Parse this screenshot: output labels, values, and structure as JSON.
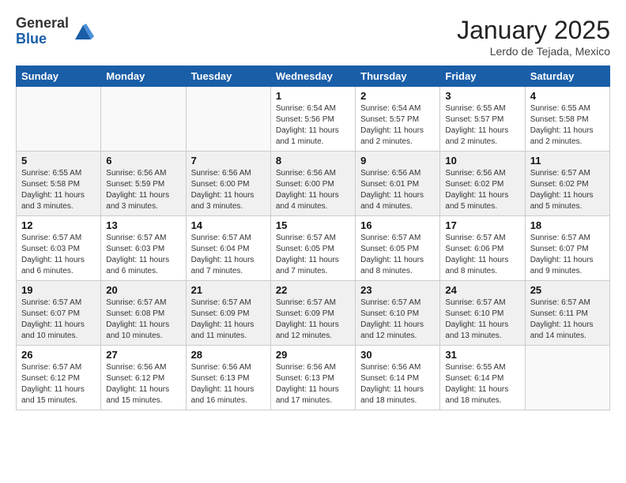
{
  "header": {
    "logo_general": "General",
    "logo_blue": "Blue",
    "month_title": "January 2025",
    "location": "Lerdo de Tejada, Mexico"
  },
  "weekdays": [
    "Sunday",
    "Monday",
    "Tuesday",
    "Wednesday",
    "Thursday",
    "Friday",
    "Saturday"
  ],
  "weeks": [
    {
      "shaded": false,
      "days": [
        {
          "number": "",
          "text": ""
        },
        {
          "number": "",
          "text": ""
        },
        {
          "number": "",
          "text": ""
        },
        {
          "number": "1",
          "text": "Sunrise: 6:54 AM\nSunset: 5:56 PM\nDaylight: 11 hours and 1 minute."
        },
        {
          "number": "2",
          "text": "Sunrise: 6:54 AM\nSunset: 5:57 PM\nDaylight: 11 hours and 2 minutes."
        },
        {
          "number": "3",
          "text": "Sunrise: 6:55 AM\nSunset: 5:57 PM\nDaylight: 11 hours and 2 minutes."
        },
        {
          "number": "4",
          "text": "Sunrise: 6:55 AM\nSunset: 5:58 PM\nDaylight: 11 hours and 2 minutes."
        }
      ]
    },
    {
      "shaded": true,
      "days": [
        {
          "number": "5",
          "text": "Sunrise: 6:55 AM\nSunset: 5:58 PM\nDaylight: 11 hours and 3 minutes."
        },
        {
          "number": "6",
          "text": "Sunrise: 6:56 AM\nSunset: 5:59 PM\nDaylight: 11 hours and 3 minutes."
        },
        {
          "number": "7",
          "text": "Sunrise: 6:56 AM\nSunset: 6:00 PM\nDaylight: 11 hours and 3 minutes."
        },
        {
          "number": "8",
          "text": "Sunrise: 6:56 AM\nSunset: 6:00 PM\nDaylight: 11 hours and 4 minutes."
        },
        {
          "number": "9",
          "text": "Sunrise: 6:56 AM\nSunset: 6:01 PM\nDaylight: 11 hours and 4 minutes."
        },
        {
          "number": "10",
          "text": "Sunrise: 6:56 AM\nSunset: 6:02 PM\nDaylight: 11 hours and 5 minutes."
        },
        {
          "number": "11",
          "text": "Sunrise: 6:57 AM\nSunset: 6:02 PM\nDaylight: 11 hours and 5 minutes."
        }
      ]
    },
    {
      "shaded": false,
      "days": [
        {
          "number": "12",
          "text": "Sunrise: 6:57 AM\nSunset: 6:03 PM\nDaylight: 11 hours and 6 minutes."
        },
        {
          "number": "13",
          "text": "Sunrise: 6:57 AM\nSunset: 6:03 PM\nDaylight: 11 hours and 6 minutes."
        },
        {
          "number": "14",
          "text": "Sunrise: 6:57 AM\nSunset: 6:04 PM\nDaylight: 11 hours and 7 minutes."
        },
        {
          "number": "15",
          "text": "Sunrise: 6:57 AM\nSunset: 6:05 PM\nDaylight: 11 hours and 7 minutes."
        },
        {
          "number": "16",
          "text": "Sunrise: 6:57 AM\nSunset: 6:05 PM\nDaylight: 11 hours and 8 minutes."
        },
        {
          "number": "17",
          "text": "Sunrise: 6:57 AM\nSunset: 6:06 PM\nDaylight: 11 hours and 8 minutes."
        },
        {
          "number": "18",
          "text": "Sunrise: 6:57 AM\nSunset: 6:07 PM\nDaylight: 11 hours and 9 minutes."
        }
      ]
    },
    {
      "shaded": true,
      "days": [
        {
          "number": "19",
          "text": "Sunrise: 6:57 AM\nSunset: 6:07 PM\nDaylight: 11 hours and 10 minutes."
        },
        {
          "number": "20",
          "text": "Sunrise: 6:57 AM\nSunset: 6:08 PM\nDaylight: 11 hours and 10 minutes."
        },
        {
          "number": "21",
          "text": "Sunrise: 6:57 AM\nSunset: 6:09 PM\nDaylight: 11 hours and 11 minutes."
        },
        {
          "number": "22",
          "text": "Sunrise: 6:57 AM\nSunset: 6:09 PM\nDaylight: 11 hours and 12 minutes."
        },
        {
          "number": "23",
          "text": "Sunrise: 6:57 AM\nSunset: 6:10 PM\nDaylight: 11 hours and 12 minutes."
        },
        {
          "number": "24",
          "text": "Sunrise: 6:57 AM\nSunset: 6:10 PM\nDaylight: 11 hours and 13 minutes."
        },
        {
          "number": "25",
          "text": "Sunrise: 6:57 AM\nSunset: 6:11 PM\nDaylight: 11 hours and 14 minutes."
        }
      ]
    },
    {
      "shaded": false,
      "days": [
        {
          "number": "26",
          "text": "Sunrise: 6:57 AM\nSunset: 6:12 PM\nDaylight: 11 hours and 15 minutes."
        },
        {
          "number": "27",
          "text": "Sunrise: 6:56 AM\nSunset: 6:12 PM\nDaylight: 11 hours and 15 minutes."
        },
        {
          "number": "28",
          "text": "Sunrise: 6:56 AM\nSunset: 6:13 PM\nDaylight: 11 hours and 16 minutes."
        },
        {
          "number": "29",
          "text": "Sunrise: 6:56 AM\nSunset: 6:13 PM\nDaylight: 11 hours and 17 minutes."
        },
        {
          "number": "30",
          "text": "Sunrise: 6:56 AM\nSunset: 6:14 PM\nDaylight: 11 hours and 18 minutes."
        },
        {
          "number": "31",
          "text": "Sunrise: 6:55 AM\nSunset: 6:14 PM\nDaylight: 11 hours and 18 minutes."
        },
        {
          "number": "",
          "text": ""
        }
      ]
    }
  ]
}
